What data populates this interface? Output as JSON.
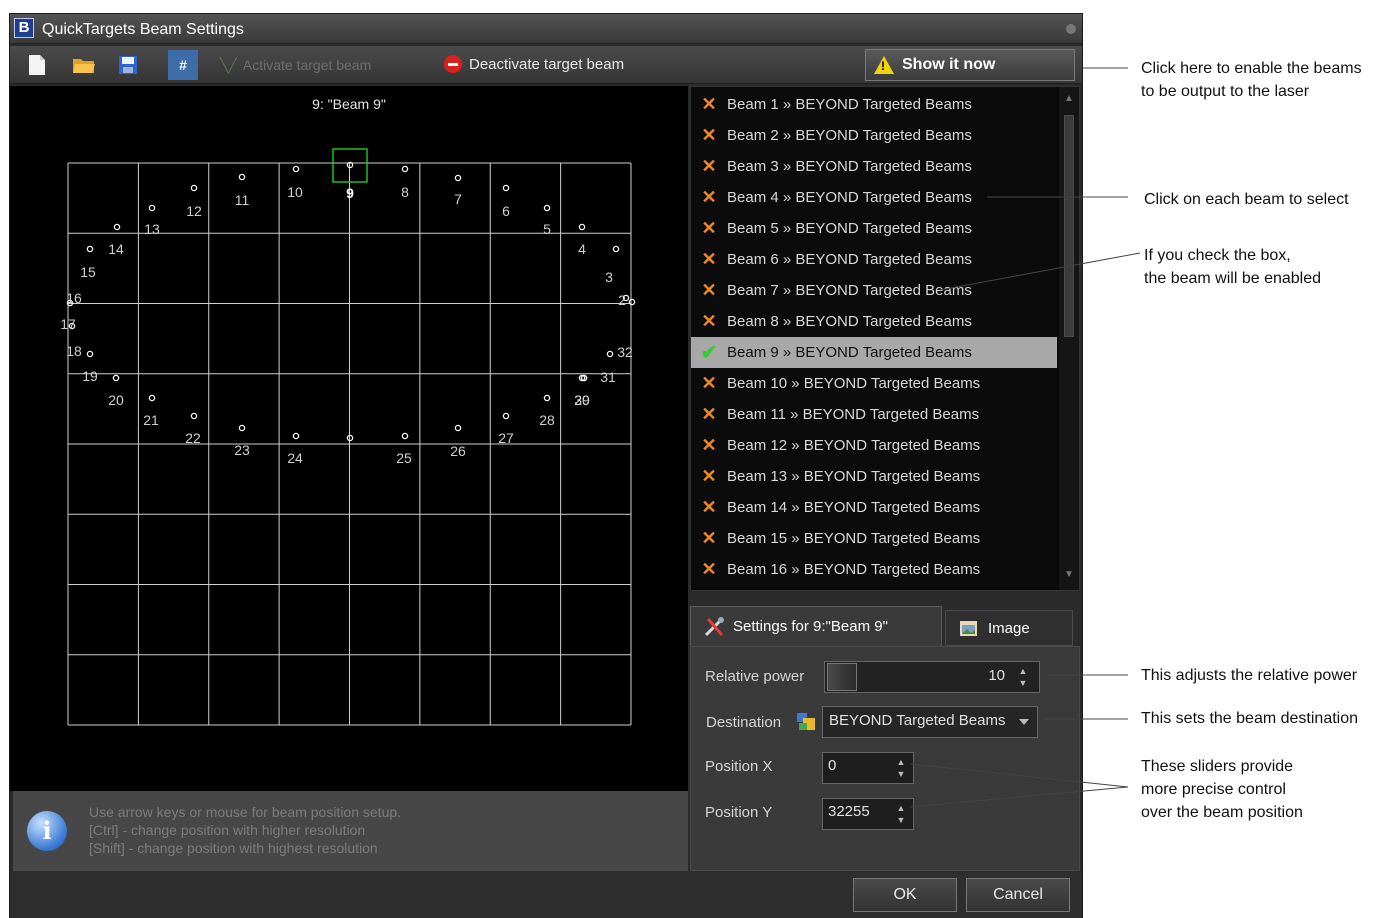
{
  "window": {
    "title": "QuickTargets Beam Settings"
  },
  "toolbar": {
    "new_icon": "new-file-icon",
    "open_icon": "folder-open-icon",
    "save_icon": "save-icon",
    "grid_toggle_label": "#",
    "activate_label": "Activate target beam",
    "deactivate_label": "Deactivate target beam",
    "show_label": "Show it now"
  },
  "canvas": {
    "title": "9: \"Beam 9\"",
    "points": [
      {
        "n": "1"
      },
      {
        "n": "2"
      },
      {
        "n": "3"
      },
      {
        "n": "4"
      },
      {
        "n": "5"
      },
      {
        "n": "6"
      },
      {
        "n": "7"
      },
      {
        "n": "8"
      },
      {
        "n": "9"
      },
      {
        "n": "10"
      },
      {
        "n": "11"
      },
      {
        "n": "12"
      },
      {
        "n": "13"
      },
      {
        "n": "14"
      },
      {
        "n": "15"
      },
      {
        "n": "16"
      },
      {
        "n": "17"
      },
      {
        "n": "18"
      },
      {
        "n": "19"
      },
      {
        "n": "20"
      },
      {
        "n": "21"
      },
      {
        "n": "22"
      },
      {
        "n": "23"
      },
      {
        "n": "24"
      },
      {
        "n": "25"
      },
      {
        "n": "26"
      },
      {
        "n": "27"
      },
      {
        "n": "28"
      },
      {
        "n": "29"
      },
      {
        "n": "30"
      },
      {
        "n": "31"
      },
      {
        "n": "32"
      }
    ],
    "selected": "9"
  },
  "info": {
    "icon": "info-icon",
    "lines": [
      "Use arrow keys or mouse for beam position setup.",
      "[Ctrl] - change position with higher resolution",
      "[Shift] - change position with highest resolution"
    ]
  },
  "beams": [
    {
      "label": "Beam 1 » BEYOND Targeted Beams",
      "enabled": false
    },
    {
      "label": "Beam 2 » BEYOND Targeted Beams",
      "enabled": false
    },
    {
      "label": "Beam 3 » BEYOND Targeted Beams",
      "enabled": false
    },
    {
      "label": "Beam 4 » BEYOND Targeted Beams",
      "enabled": false
    },
    {
      "label": "Beam 5 » BEYOND Targeted Beams",
      "enabled": false
    },
    {
      "label": "Beam 6 » BEYOND Targeted Beams",
      "enabled": false
    },
    {
      "label": "Beam 7 » BEYOND Targeted Beams",
      "enabled": false
    },
    {
      "label": "Beam 8 » BEYOND Targeted Beams",
      "enabled": false
    },
    {
      "label": "Beam 9 » BEYOND Targeted Beams",
      "enabled": true
    },
    {
      "label": "Beam 10 » BEYOND Targeted Beams",
      "enabled": false
    },
    {
      "label": "Beam 11 » BEYOND Targeted Beams",
      "enabled": false
    },
    {
      "label": "Beam 12 » BEYOND Targeted Beams",
      "enabled": false
    },
    {
      "label": "Beam 13 » BEYOND Targeted Beams",
      "enabled": false
    },
    {
      "label": "Beam 14 » BEYOND Targeted Beams",
      "enabled": false
    },
    {
      "label": "Beam 15 » BEYOND Targeted Beams",
      "enabled": false
    },
    {
      "label": "Beam 16 » BEYOND Targeted Beams",
      "enabled": false
    }
  ],
  "tabs": {
    "settings_label": "Settings for 9:\"Beam 9\"",
    "image_label": "Image"
  },
  "settings": {
    "power_label": "Relative power",
    "power_value": "10",
    "destination_label": "Destination",
    "destination_value": "BEYOND Targeted Beams",
    "pos_x_label": "Position X",
    "pos_x_value": "0",
    "pos_y_label": "Position Y",
    "pos_y_value": "32255"
  },
  "footer": {
    "ok_label": "OK",
    "cancel_label": "Cancel"
  },
  "annotations": {
    "show_line1": "Click here to enable the beams",
    "show_line2": "to be output to the laser",
    "select": "Click on each beam to select",
    "check_line1": "If you check the box,",
    "check_line2": "the beam will be enabled",
    "power": "This adjusts the relative power",
    "dest": "This sets the beam destination",
    "pos_line1": "These sliders provide",
    "pos_line2": "more precise control",
    "pos_line3": "over the beam position"
  },
  "colors": {
    "disabled_mark": "#f08a1c",
    "enabled_mark": "#33cc33",
    "selected_box": "#1fbf1f",
    "warning": "#f2d20c"
  }
}
